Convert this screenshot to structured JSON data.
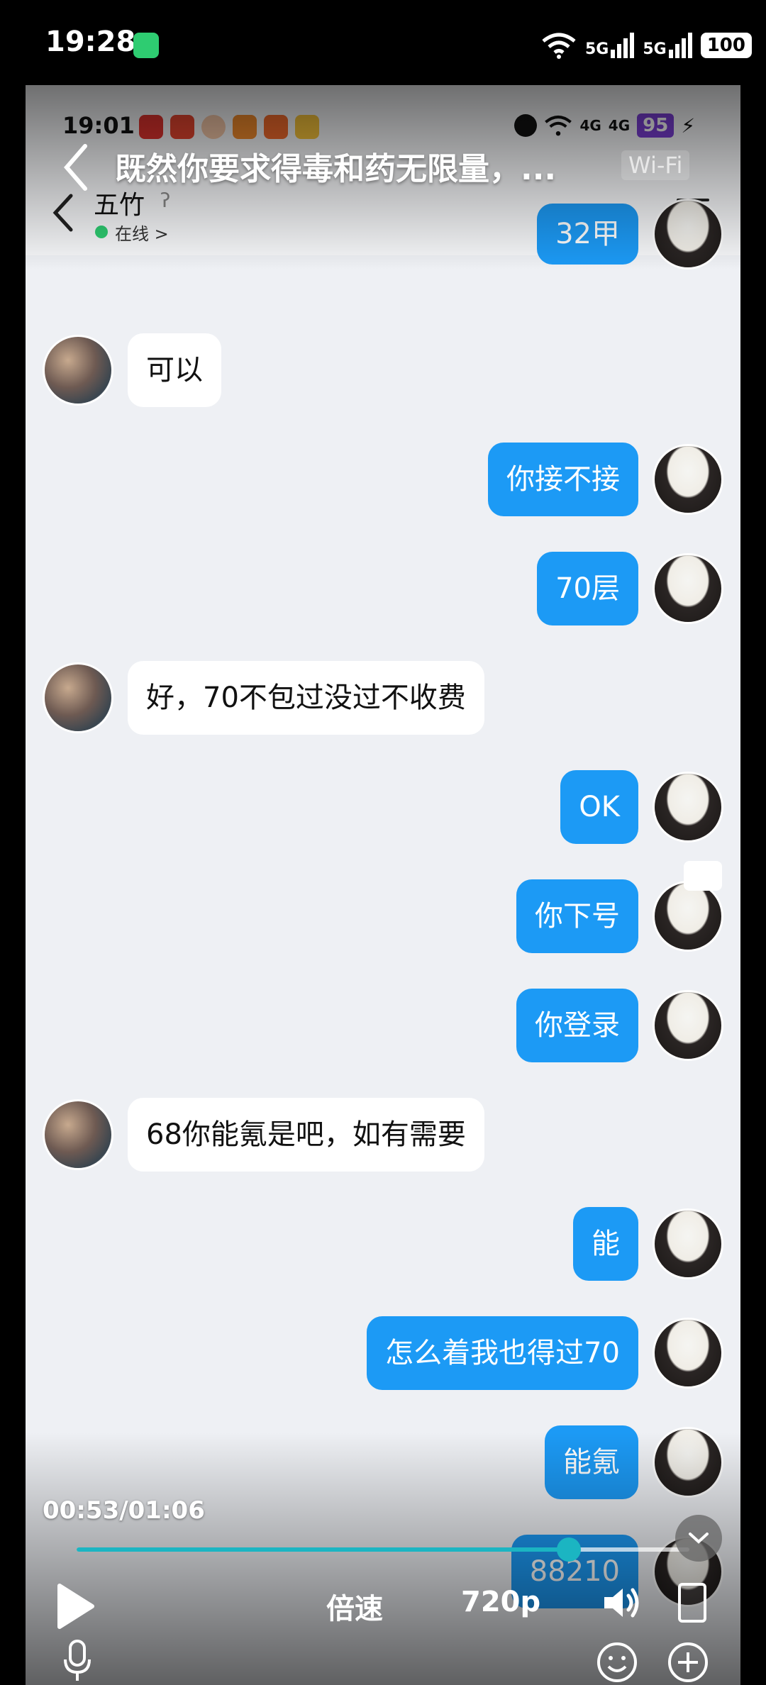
{
  "outer_status": {
    "time": "19:28",
    "signal1": "5G",
    "signal2": "5G",
    "battery": "100"
  },
  "inner_status": {
    "time": "19:01",
    "signal1": "4G",
    "signal2": "4G",
    "battery": "95"
  },
  "video": {
    "title": "既然你要求得毒和药无限量，...",
    "wifi_badge": "Wi-Fi",
    "time_display": "00:53/01:06",
    "progress_fraction": 0.803,
    "speed_label": "倍速",
    "quality_label": "720p"
  },
  "chat": {
    "contact_name": "五竹",
    "status": "在线 >",
    "accent": "#1c9af5",
    "messages": [
      {
        "side": "right",
        "text": "32甲"
      },
      {
        "side": "left",
        "text": "可以"
      },
      {
        "side": "right",
        "text": "你接不接"
      },
      {
        "side": "right",
        "text": "70层"
      },
      {
        "side": "left",
        "text": "好，70不包过没过不收费"
      },
      {
        "side": "right",
        "text": "OK"
      },
      {
        "side": "right",
        "text": "你下号"
      },
      {
        "side": "right",
        "text": "你登录"
      },
      {
        "side": "left",
        "text": "68你能氪是吧，如有需要"
      },
      {
        "side": "right",
        "text": "能"
      },
      {
        "side": "right",
        "text": "怎么着我也得过70"
      },
      {
        "side": "right",
        "text": "能氪"
      },
      {
        "side": "right",
        "text": "88210"
      }
    ]
  }
}
